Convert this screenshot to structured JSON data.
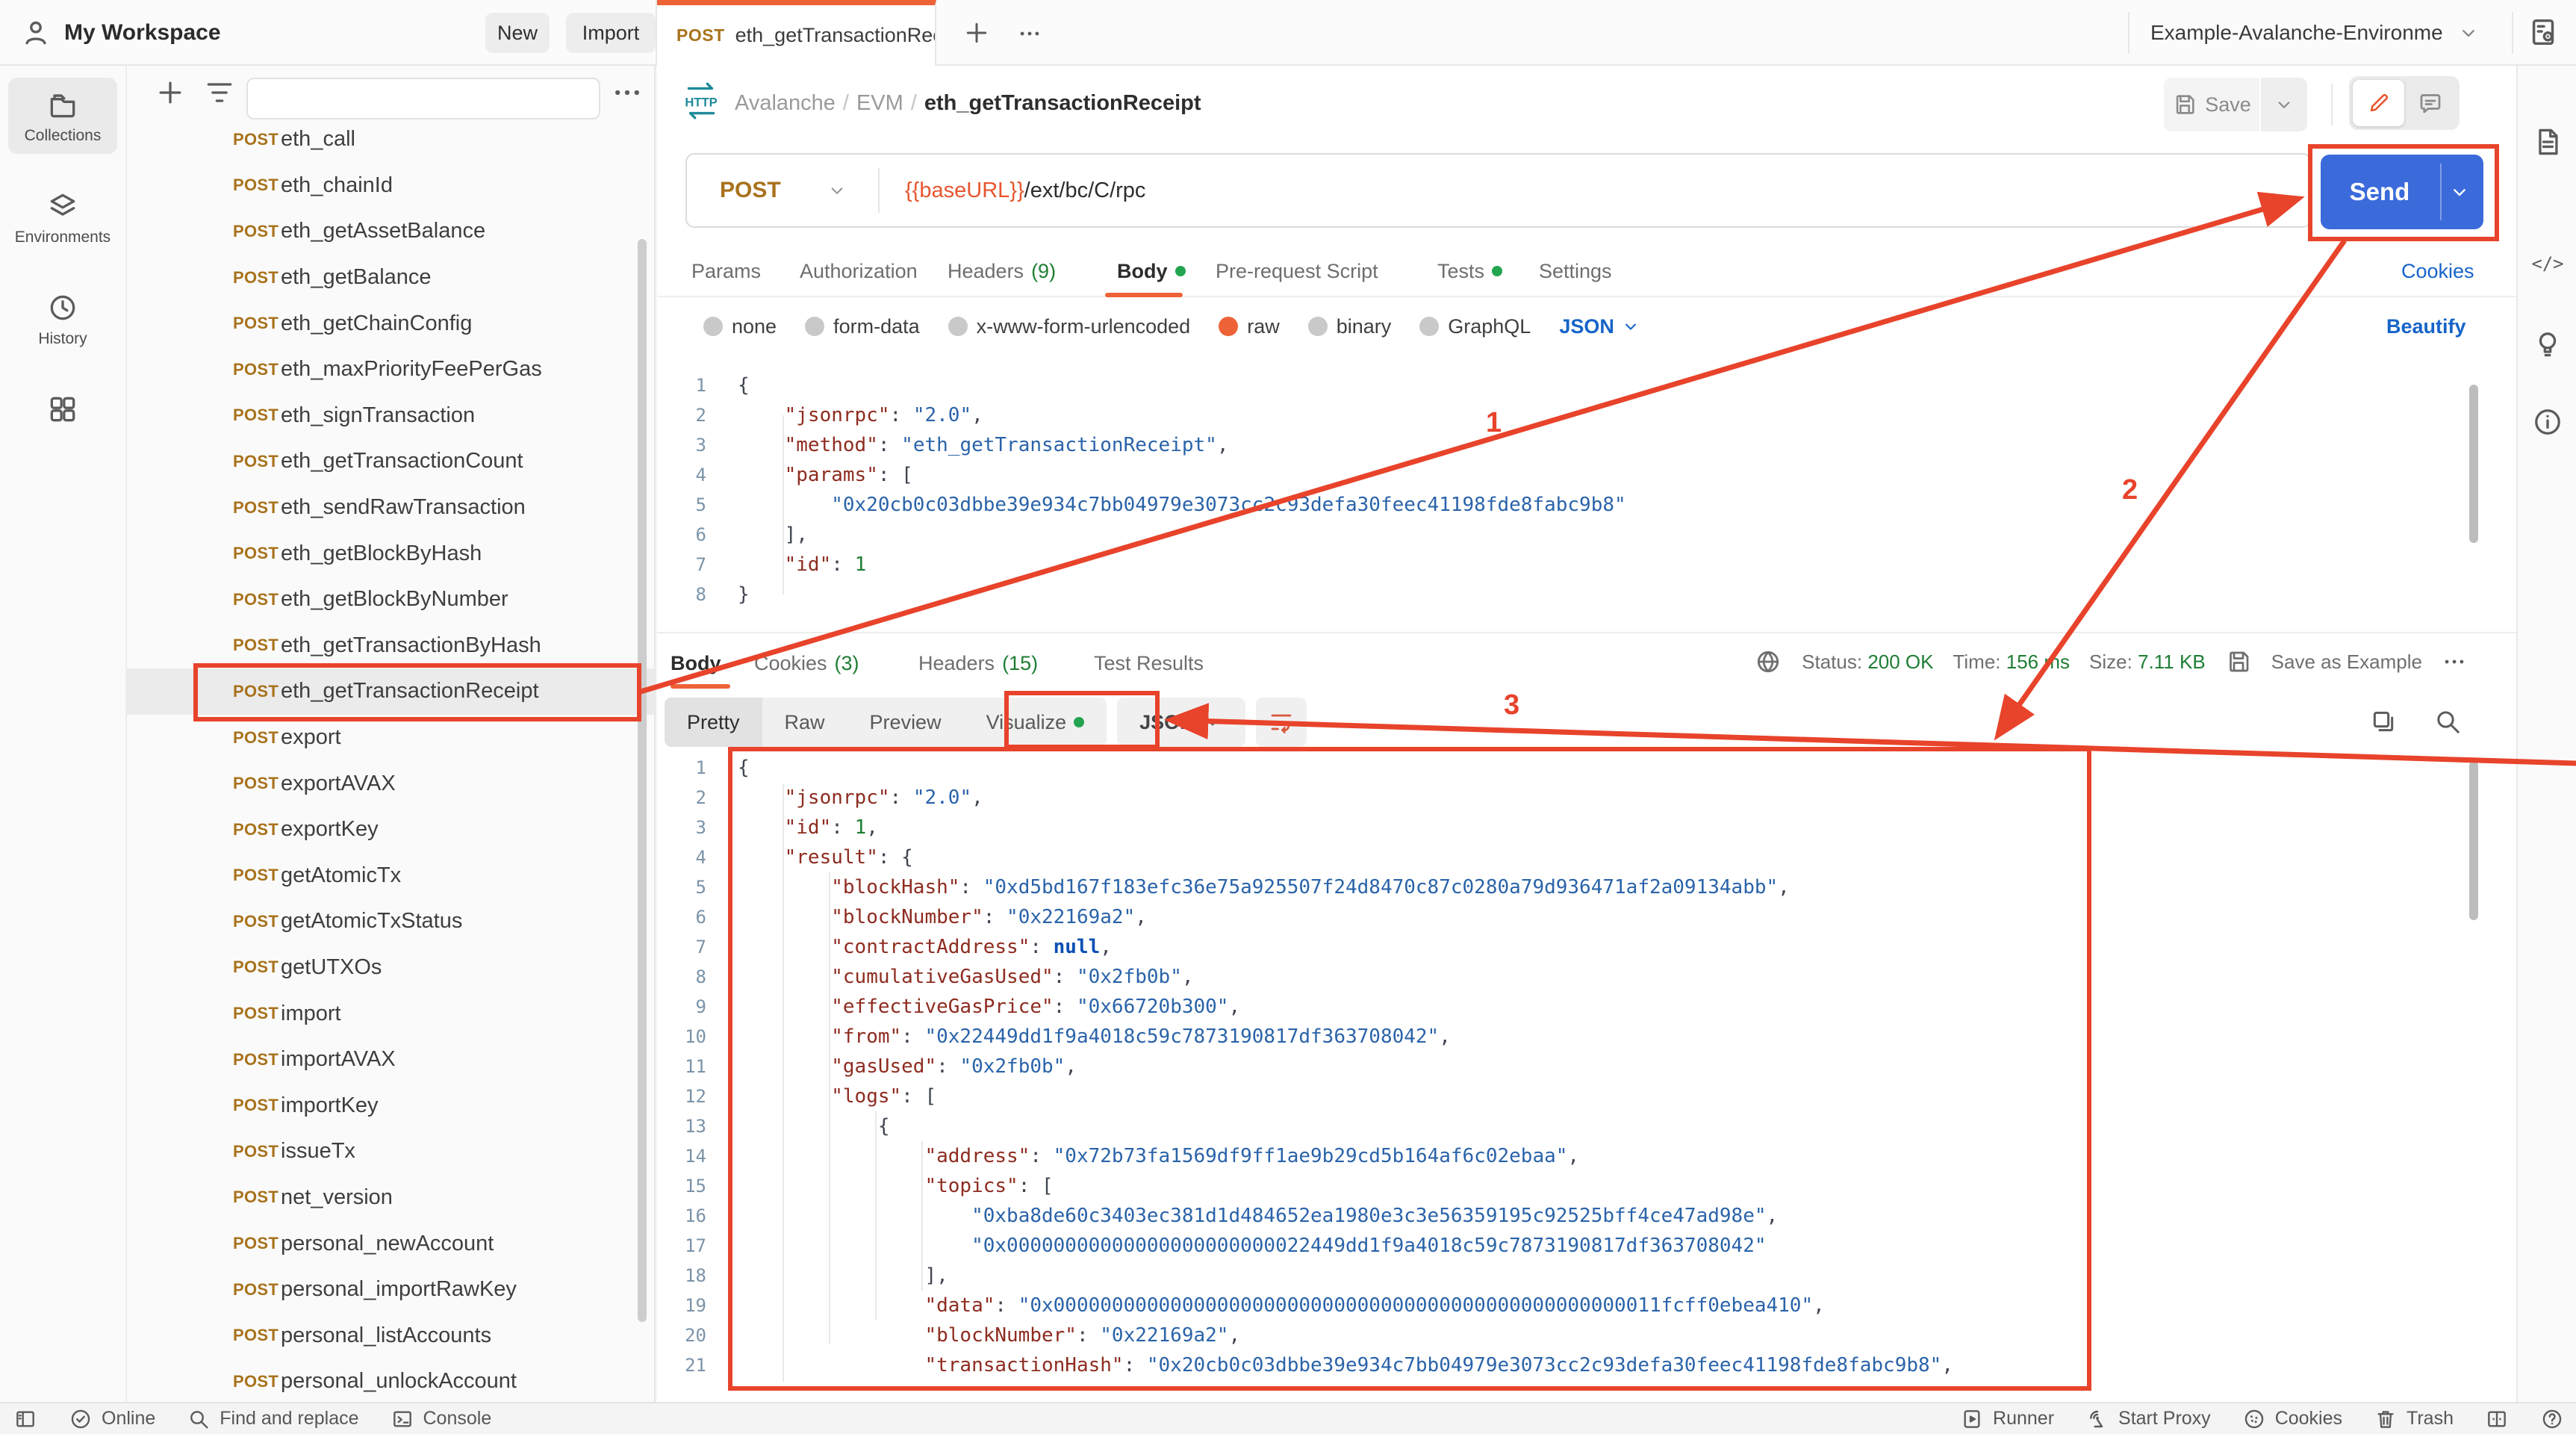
{
  "header": {
    "workspace": "My Workspace",
    "new_label": "New",
    "import_label": "Import",
    "tab": {
      "method": "POST",
      "title": "eth_getTransactionRece"
    },
    "environment": "Example-Avalanche-Environme"
  },
  "left_rail": {
    "items": [
      {
        "icon": "collections",
        "label": "Collections",
        "active": true
      },
      {
        "icon": "environments",
        "label": "Environments",
        "active": false
      },
      {
        "icon": "history",
        "label": "History",
        "active": false
      },
      {
        "icon": "grid",
        "label": "",
        "active": false
      }
    ]
  },
  "sidebar": {
    "method": "POST",
    "active_index": 12,
    "items": [
      "eth_call",
      "eth_chainId",
      "eth_getAssetBalance",
      "eth_getBalance",
      "eth_getChainConfig",
      "eth_maxPriorityFeePerGas",
      "eth_signTransaction",
      "eth_getTransactionCount",
      "eth_sendRawTransaction",
      "eth_getBlockByHash",
      "eth_getBlockByNumber",
      "eth_getTransactionByHash",
      "eth_getTransactionReceipt",
      "export",
      "exportAVAX",
      "exportKey",
      "getAtomicTx",
      "getAtomicTxStatus",
      "getUTXOs",
      "import",
      "importAVAX",
      "importKey",
      "issueTx",
      "net_version",
      "personal_newAccount",
      "personal_importRawKey",
      "personal_listAccounts",
      "personal_unlockAccount"
    ]
  },
  "request": {
    "breadcrumb": {
      "collection": "Avalanche",
      "folder": "EVM",
      "name": "eth_getTransactionReceipt"
    },
    "save_label": "Save",
    "method": "POST",
    "url_variable": "{{baseURL}}",
    "url_path": "/ext/bc/C/rpc",
    "send_label": "Send",
    "cookies_link": "Cookies",
    "beautify_link": "Beautify",
    "language": "JSON",
    "tabs": [
      {
        "label": "Params"
      },
      {
        "label": "Authorization"
      },
      {
        "label": "Headers",
        "count": "(9)"
      },
      {
        "label": "Body",
        "active": true,
        "dot": true
      },
      {
        "label": "Pre-request Script"
      },
      {
        "label": "Tests",
        "dot": true
      },
      {
        "label": "Settings"
      }
    ],
    "body_types": [
      {
        "label": "none"
      },
      {
        "label": "form-data"
      },
      {
        "label": "x-www-form-urlencoded"
      },
      {
        "label": "raw",
        "selected": true
      },
      {
        "label": "binary"
      },
      {
        "label": "GraphQL"
      }
    ],
    "editor_lines": [
      [
        [
          "p",
          "{"
        ]
      ],
      [
        [
          "p",
          "    "
        ],
        [
          "k",
          "\"jsonrpc\""
        ],
        [
          "p",
          ": "
        ],
        [
          "s",
          "\"2.0\""
        ],
        [
          "p",
          ","
        ]
      ],
      [
        [
          "p",
          "    "
        ],
        [
          "k",
          "\"method\""
        ],
        [
          "p",
          ": "
        ],
        [
          "s",
          "\"eth_getTransactionReceipt\""
        ],
        [
          "p",
          ","
        ]
      ],
      [
        [
          "p",
          "    "
        ],
        [
          "k",
          "\"params\""
        ],
        [
          "p",
          ": ["
        ]
      ],
      [
        [
          "p",
          "        "
        ],
        [
          "s",
          "\"0x20cb0c03dbbe39e934c7bb04979e3073cc2c93defa30feec41198fde8fabc9b8\""
        ]
      ],
      [
        [
          "p",
          "    ],"
        ]
      ],
      [
        [
          "p",
          "    "
        ],
        [
          "k",
          "\"id\""
        ],
        [
          "p",
          ": "
        ],
        [
          "n",
          "1"
        ]
      ],
      [
        [
          "p",
          "}"
        ]
      ]
    ]
  },
  "response": {
    "tabs": [
      {
        "label": "Body",
        "active": true
      },
      {
        "label": "Cookies",
        "count": "(3)"
      },
      {
        "label": "Headers",
        "count": "(15)"
      },
      {
        "label": "Test Results"
      }
    ],
    "meta": {
      "status_label": "Status:",
      "status": "200 OK",
      "time_label": "Time:",
      "time": "156 ms",
      "size_label": "Size:",
      "size": "7.11 KB",
      "save_example": "Save as Example"
    },
    "view_tabs": [
      {
        "label": "Pretty",
        "active": true
      },
      {
        "label": "Raw"
      },
      {
        "label": "Preview"
      },
      {
        "label": "Visualize",
        "dot": true
      }
    ],
    "language": "JSON",
    "editor_lines": [
      [
        [
          "p",
          "{"
        ]
      ],
      [
        [
          "p",
          "    "
        ],
        [
          "k",
          "\"jsonrpc\""
        ],
        [
          "p",
          ": "
        ],
        [
          "s",
          "\"2.0\""
        ],
        [
          "p",
          ","
        ]
      ],
      [
        [
          "p",
          "    "
        ],
        [
          "k",
          "\"id\""
        ],
        [
          "p",
          ": "
        ],
        [
          "n",
          "1"
        ],
        [
          "p",
          ","
        ]
      ],
      [
        [
          "p",
          "    "
        ],
        [
          "k",
          "\"result\""
        ],
        [
          "p",
          ": {"
        ]
      ],
      [
        [
          "p",
          "        "
        ],
        [
          "k",
          "\"blockHash\""
        ],
        [
          "p",
          ": "
        ],
        [
          "s",
          "\"0xd5bd167f183efc36e75a925507f24d8470c87c0280a79d936471af2a09134abb\""
        ],
        [
          "p",
          ","
        ]
      ],
      [
        [
          "p",
          "        "
        ],
        [
          "k",
          "\"blockNumber\""
        ],
        [
          "p",
          ": "
        ],
        [
          "s",
          "\"0x22169a2\""
        ],
        [
          "p",
          ","
        ]
      ],
      [
        [
          "p",
          "        "
        ],
        [
          "k",
          "\"contractAddress\""
        ],
        [
          "p",
          ": "
        ],
        [
          "u",
          "null"
        ],
        [
          "p",
          ","
        ]
      ],
      [
        [
          "p",
          "        "
        ],
        [
          "k",
          "\"cumulativeGasUsed\""
        ],
        [
          "p",
          ": "
        ],
        [
          "s",
          "\"0x2fb0b\""
        ],
        [
          "p",
          ","
        ]
      ],
      [
        [
          "p",
          "        "
        ],
        [
          "k",
          "\"effectiveGasPrice\""
        ],
        [
          "p",
          ": "
        ],
        [
          "s",
          "\"0x66720b300\""
        ],
        [
          "p",
          ","
        ]
      ],
      [
        [
          "p",
          "        "
        ],
        [
          "k",
          "\"from\""
        ],
        [
          "p",
          ": "
        ],
        [
          "s",
          "\"0x22449dd1f9a4018c59c7873190817df363708042\""
        ],
        [
          "p",
          ","
        ]
      ],
      [
        [
          "p",
          "        "
        ],
        [
          "k",
          "\"gasUsed\""
        ],
        [
          "p",
          ": "
        ],
        [
          "s",
          "\"0x2fb0b\""
        ],
        [
          "p",
          ","
        ]
      ],
      [
        [
          "p",
          "        "
        ],
        [
          "k",
          "\"logs\""
        ],
        [
          "p",
          ": ["
        ]
      ],
      [
        [
          "p",
          "            {"
        ]
      ],
      [
        [
          "p",
          "                "
        ],
        [
          "k",
          "\"address\""
        ],
        [
          "p",
          ": "
        ],
        [
          "s",
          "\"0x72b73fa1569df9ff1ae9b29cd5b164af6c02ebaa\""
        ],
        [
          "p",
          ","
        ]
      ],
      [
        [
          "p",
          "                "
        ],
        [
          "k",
          "\"topics\""
        ],
        [
          "p",
          ": ["
        ]
      ],
      [
        [
          "p",
          "                    "
        ],
        [
          "s",
          "\"0xba8de60c3403ec381d1d484652ea1980e3c3e56359195c92525bff4ce47ad98e\""
        ],
        [
          "p",
          ","
        ]
      ],
      [
        [
          "p",
          "                    "
        ],
        [
          "s",
          "\"0x00000000000000000000000022449dd1f9a4018c59c7873190817df363708042\""
        ]
      ],
      [
        [
          "p",
          "                ],"
        ]
      ],
      [
        [
          "p",
          "                "
        ],
        [
          "k",
          "\"data\""
        ],
        [
          "p",
          ": "
        ],
        [
          "s",
          "\"0x0000000000000000000000000000000000000000000000000011fcff0ebea410\""
        ],
        [
          "p",
          ","
        ]
      ],
      [
        [
          "p",
          "                "
        ],
        [
          "k",
          "\"blockNumber\""
        ],
        [
          "p",
          ": "
        ],
        [
          "s",
          "\"0x22169a2\""
        ],
        [
          "p",
          ","
        ]
      ],
      [
        [
          "p",
          "                "
        ],
        [
          "k",
          "\"transactionHash\""
        ],
        [
          "p",
          ": "
        ],
        [
          "s",
          "\"0x20cb0c03dbbe39e934c7bb04979e3073cc2c93defa30feec41198fde8fabc9b8\""
        ],
        [
          "p",
          ","
        ]
      ]
    ]
  },
  "status_bar": {
    "left": [
      {
        "icon": "panel",
        "label": ""
      },
      {
        "icon": "check-circle",
        "label": "Online"
      },
      {
        "icon": "search",
        "label": "Find and replace"
      },
      {
        "icon": "console",
        "label": "Console"
      }
    ],
    "right": [
      {
        "icon": "runner",
        "label": "Runner"
      },
      {
        "icon": "proxy",
        "label": "Start Proxy"
      },
      {
        "icon": "cookie",
        "label": "Cookies"
      },
      {
        "icon": "trash",
        "label": "Trash"
      },
      {
        "icon": "split",
        "label": ""
      },
      {
        "icon": "help",
        "label": ""
      }
    ]
  },
  "annotations": {
    "color": "#e8432b",
    "labels": [
      "1",
      "2",
      "3"
    ]
  },
  "colors": {
    "accent_orange": "#ee6237",
    "send_blue": "#3b6bdb",
    "link_blue": "#1664c9",
    "green": "#1e7e34",
    "method_amber": "#a8721c",
    "annotation_red": "#e8432b"
  }
}
